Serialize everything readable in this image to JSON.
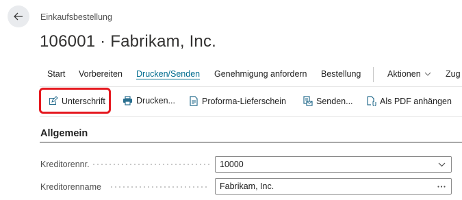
{
  "header": {
    "caption": "Einkaufsbestellung",
    "title": "106001 · Fabrikam, Inc."
  },
  "tabs": [
    {
      "label": "Start",
      "active": false
    },
    {
      "label": "Vorbereiten",
      "active": false
    },
    {
      "label": "Drucken/Senden",
      "active": true
    },
    {
      "label": "Genehmigung anfordern",
      "active": false
    },
    {
      "label": "Bestellung",
      "active": false
    },
    {
      "label": "Aktionen",
      "active": false
    },
    {
      "label": "Zug",
      "active": false
    }
  ],
  "actions": [
    {
      "label": "Unterschrift",
      "icon": "signature-icon",
      "highlighted": true
    },
    {
      "label": "Drucken...",
      "icon": "printer-icon"
    },
    {
      "label": "Proforma-Lieferschein",
      "icon": "document-icon"
    },
    {
      "label": "Senden...",
      "icon": "send-icon"
    },
    {
      "label": "Als PDF anhängen",
      "icon": "pdf-attach-icon"
    }
  ],
  "section": {
    "title": "Allgemein"
  },
  "fields": [
    {
      "label": "Kreditorennr.",
      "value": "10000",
      "control": "dropdown"
    },
    {
      "label": "Kreditorenname",
      "value": "Fabrikam, Inc.",
      "control": "lookup"
    }
  ],
  "colors": {
    "accent": "#006c8f",
    "highlight": "#e5181f",
    "icon": "#2a6f8f"
  }
}
